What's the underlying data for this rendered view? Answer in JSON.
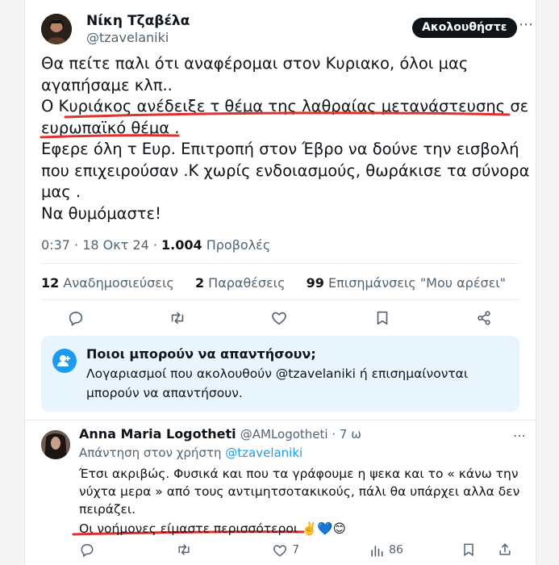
{
  "tweet": {
    "author_name": "Νίκη Τζαβέλα",
    "author_handle": "@tzavelaniki",
    "follow_label": "Ακολουθήστε",
    "lines": [
      "Θα πείτε παλι ότι αναφέρομαι στον Κυριακο, όλοι μας",
      "αγαπήσαμε κλπ..",
      "Ο Κυριάκος ανέδειξε τ θέμα της λαθραίας μετανάστευσης σε",
      "ευρωπαϊκό θέμα .",
      "Εφερε όλη τ Ευρ. Επιτροπή στον Έβρο να δούνε την εισβολή",
      "που επιχειρούσαν .Κ χωρίς ενδοιασμούς, θωράκισε τα σύνορα",
      "μας .",
      "Να θυμόμαστε!"
    ],
    "time": "0:37",
    "date": "18 Οκτ 24",
    "views_count": "1.004",
    "views_label": "Προβολές",
    "reposts_count": "12",
    "reposts_label": "Αναδημοσιεύσεις",
    "quotes_count": "2",
    "quotes_label": "Παραθέσεις",
    "likes_count": "99",
    "likes_label": "Επισημάνσεις \"Μου αρέσει\""
  },
  "reply_restriction": {
    "title": "Ποιοι μπορούν να απαντήσουν;",
    "line1": "Λογαριασμοί που ακολουθούν @tzavelaniki ή επισημαίνονται",
    "line2": "μπορούν να απαντήσουν."
  },
  "reply": {
    "author_name": "Anna Maria Logotheti",
    "author_handle": "@AMLogotheti",
    "age": "7 ω",
    "replying_to_label": "Απάντηση στον χρήστη",
    "replying_to_handle": "@tzavelaniki",
    "lines": [
      "Έτσι ακριβώς. Φυσικά και που τα γράφουμε η ψεκα και το « κάνω την",
      "νύχτα μερα » από τους αντιμητσοτακικούς, πάλι θα υπάρχει αλλα δεν",
      "πειράζει.",
      "Οι νοήμονες είμαστε περισσότεροι"
    ],
    "emojis": "✌️💙😊",
    "likes": "7",
    "views": "86"
  },
  "colors": {
    "accent": "#1d9bf0",
    "annotation_red": "#e0312f",
    "text": "#0f1419",
    "secondary": "#536471"
  },
  "icons": [
    "more-icon",
    "reply-icon",
    "retweet-icon",
    "like-icon",
    "bookmark-icon",
    "share-icon",
    "people-icon",
    "views-icon"
  ]
}
